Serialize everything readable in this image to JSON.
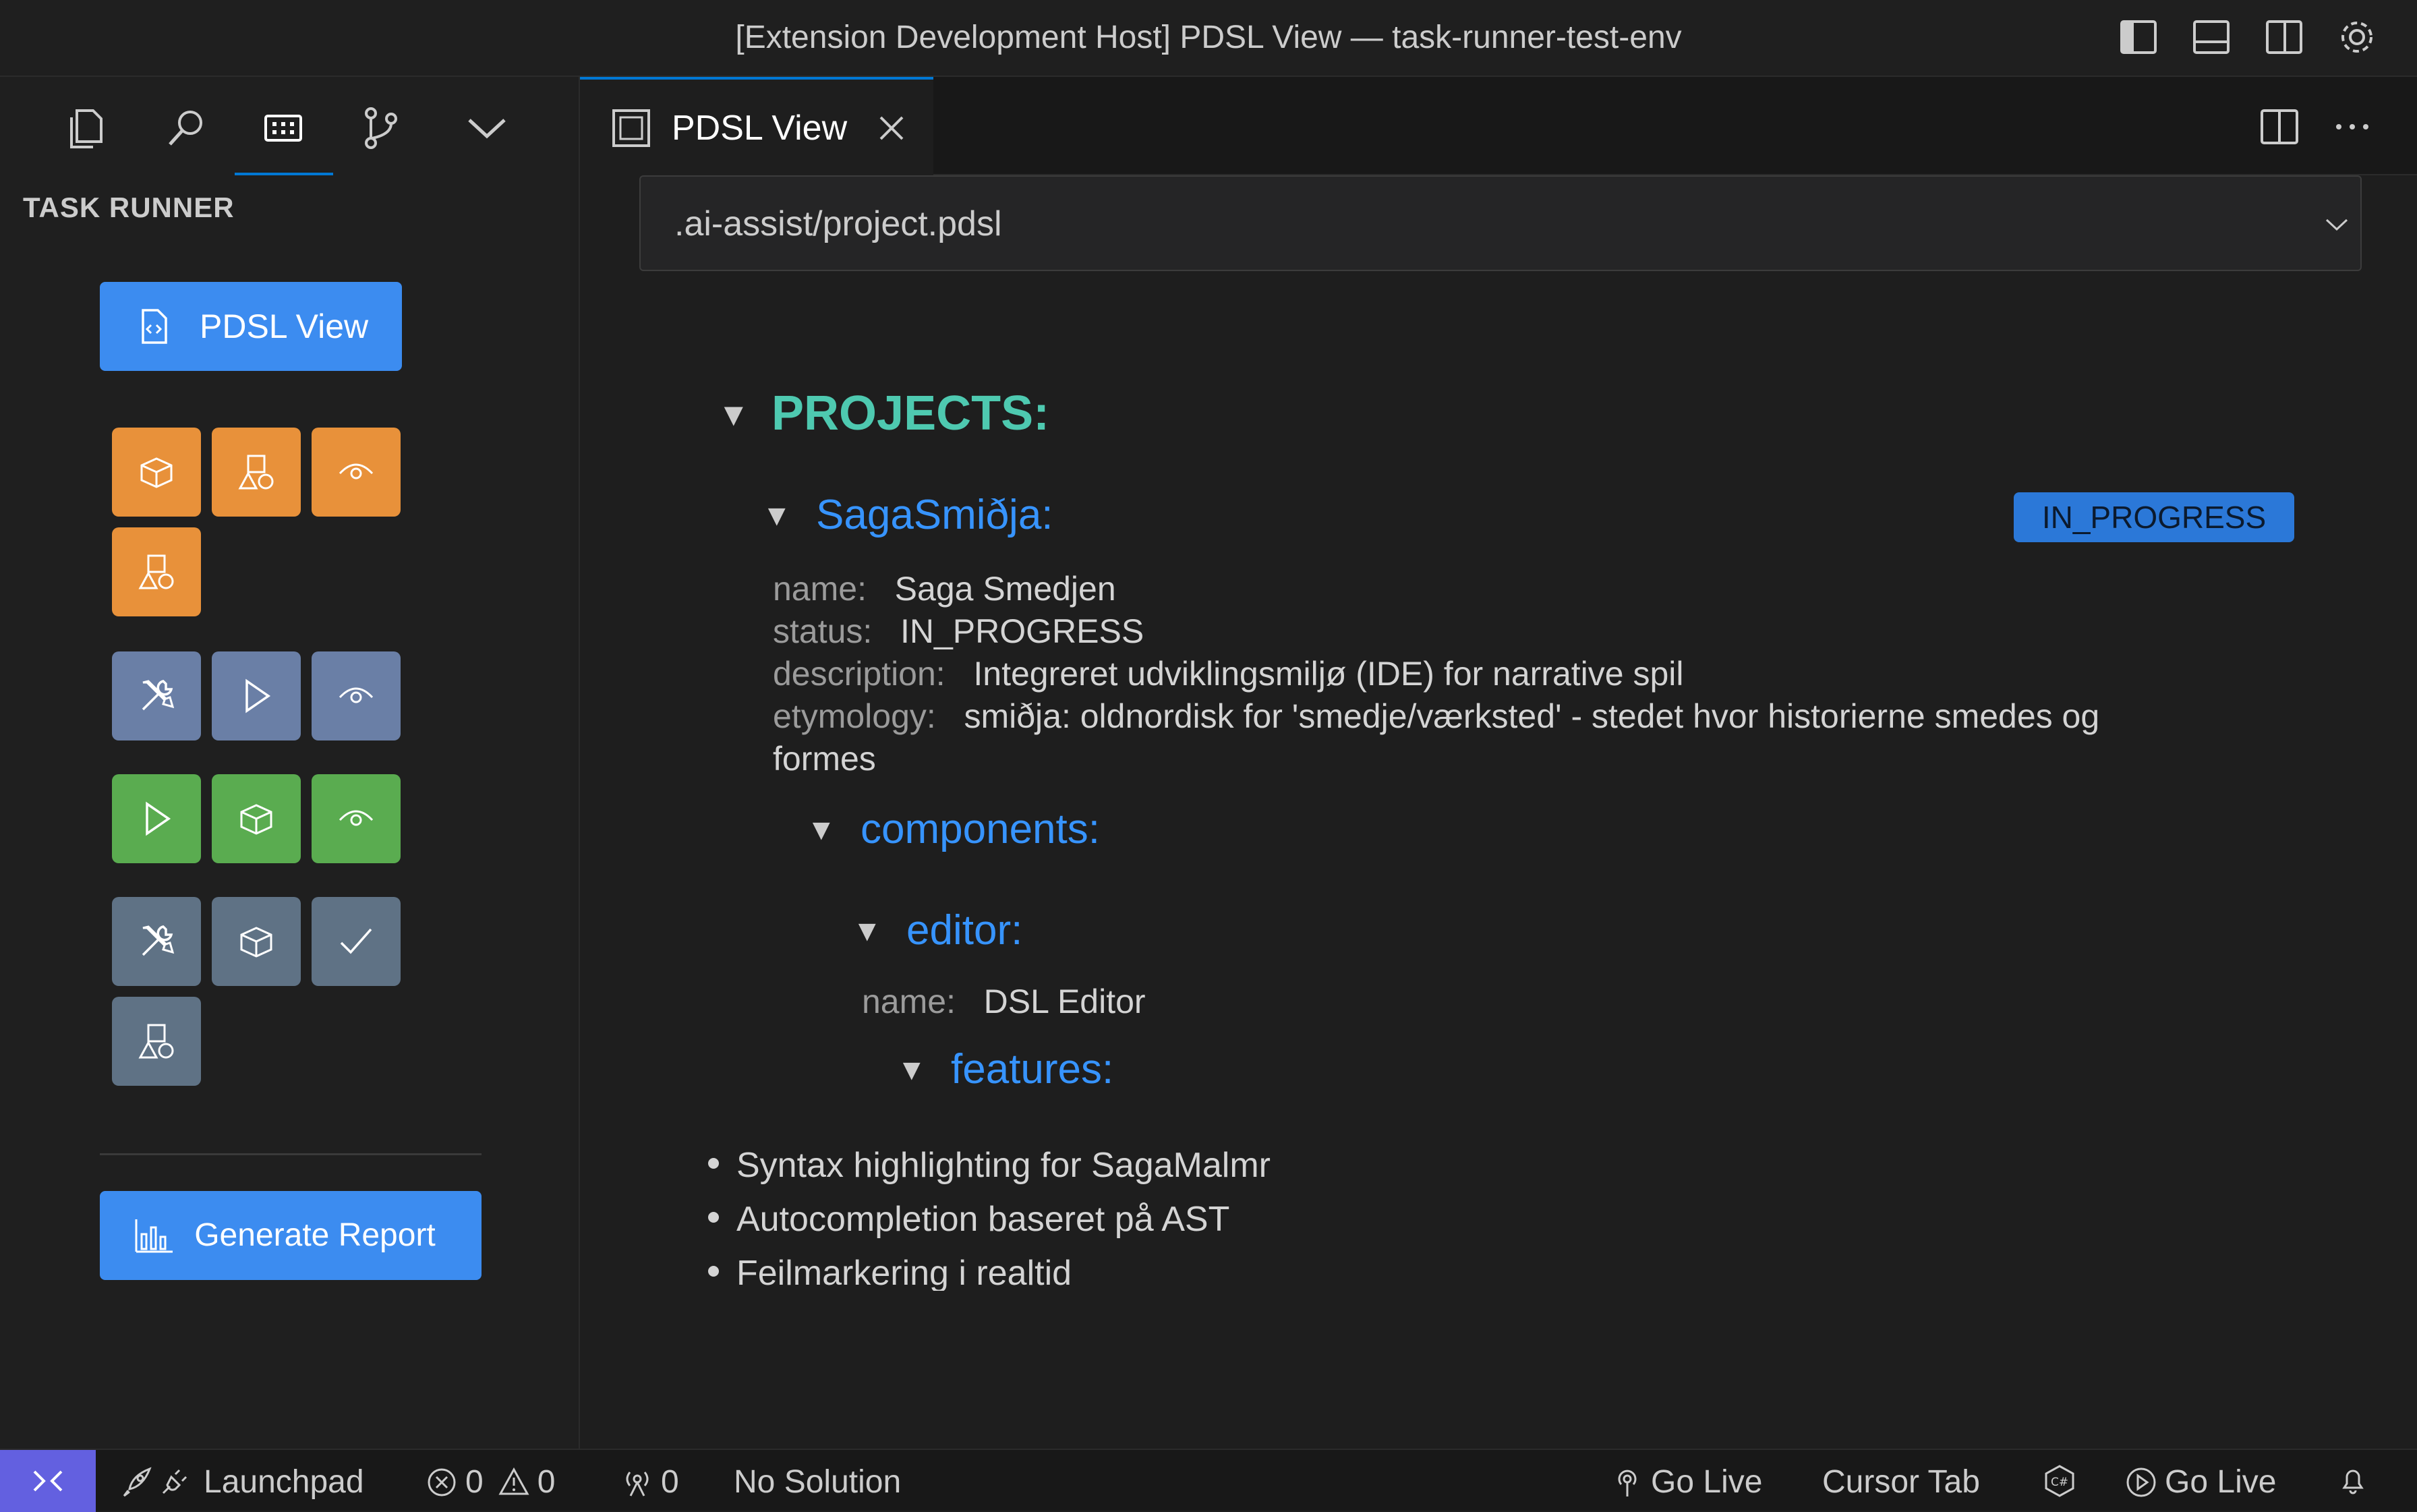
{
  "window": {
    "title": "[Extension Development Host] PDSL View — task-runner-test-env"
  },
  "titlebar_icons": [
    "toggle-primary-sidebar-icon",
    "toggle-panel-icon",
    "toggle-secondary-sidebar-icon",
    "gear-icon"
  ],
  "activity_icons": [
    "explorer-icon",
    "search-icon",
    "task-runner-icon",
    "source-control-icon",
    "chevron-down-icon"
  ],
  "sidebar": {
    "title": "TASK RUNNER",
    "pdsl_button": "PDSL View",
    "tile_groups": [
      {
        "color": "#e8913a",
        "icons": [
          "box-icon",
          "shapes-icon",
          "eye-icon",
          "shapes-icon"
        ]
      },
      {
        "color": "#6a7fa6",
        "icons": [
          "tools-icon",
          "play-icon",
          "eye-icon"
        ]
      },
      {
        "color": "#5aac50",
        "icons": [
          "play-icon",
          "box-icon",
          "eye-icon"
        ]
      },
      {
        "color": "#5f7285",
        "icons": [
          "tools-icon",
          "box-icon",
          "check-icon",
          "shapes-icon"
        ]
      }
    ],
    "report_button": "Generate Report"
  },
  "tab": {
    "label": "PDSL View"
  },
  "file_select": {
    "value": ".ai-assist/project.pdsl"
  },
  "tree": {
    "projects_label": "PROJECTS:",
    "project_key": "SagaSmiðja:",
    "project_badge": "IN_PROGRESS",
    "props": {
      "name_label": "name:",
      "name_value": "Saga Smedjen",
      "status_label": "status:",
      "status_value": "IN_PROGRESS",
      "description_label": "description:",
      "description_value": "Integreret udviklingsmiljø (IDE) for narrative spil",
      "etymology_label": "etymology:",
      "etymology_value": "smiðja: oldnordisk for 'smedje/værksted' - stedet hvor historierne smedes og",
      "etymology_value_cont": "formes"
    },
    "components_key": "components:",
    "editor_key": "editor:",
    "editor_name_label": "name:",
    "editor_name_value": "DSL Editor",
    "features_key": "features:",
    "features": [
      "Syntax highlighting for SagaMalmr",
      "Autocompletion baseret på AST",
      "Feilmarkering i realtid"
    ]
  },
  "colors": {
    "projects": "#4ec9b0",
    "keys": "#3794ff",
    "badge": "#2b78d8",
    "accent": "#0078d4",
    "remote": "#6360e0"
  },
  "statusbar": {
    "launchpad": "Launchpad",
    "errors": "0",
    "warnings": "0",
    "ports": "0",
    "solution": "No Solution",
    "go_live_1": "Go Live",
    "cursor_tab": "Cursor Tab",
    "go_live_2": "Go Live"
  }
}
